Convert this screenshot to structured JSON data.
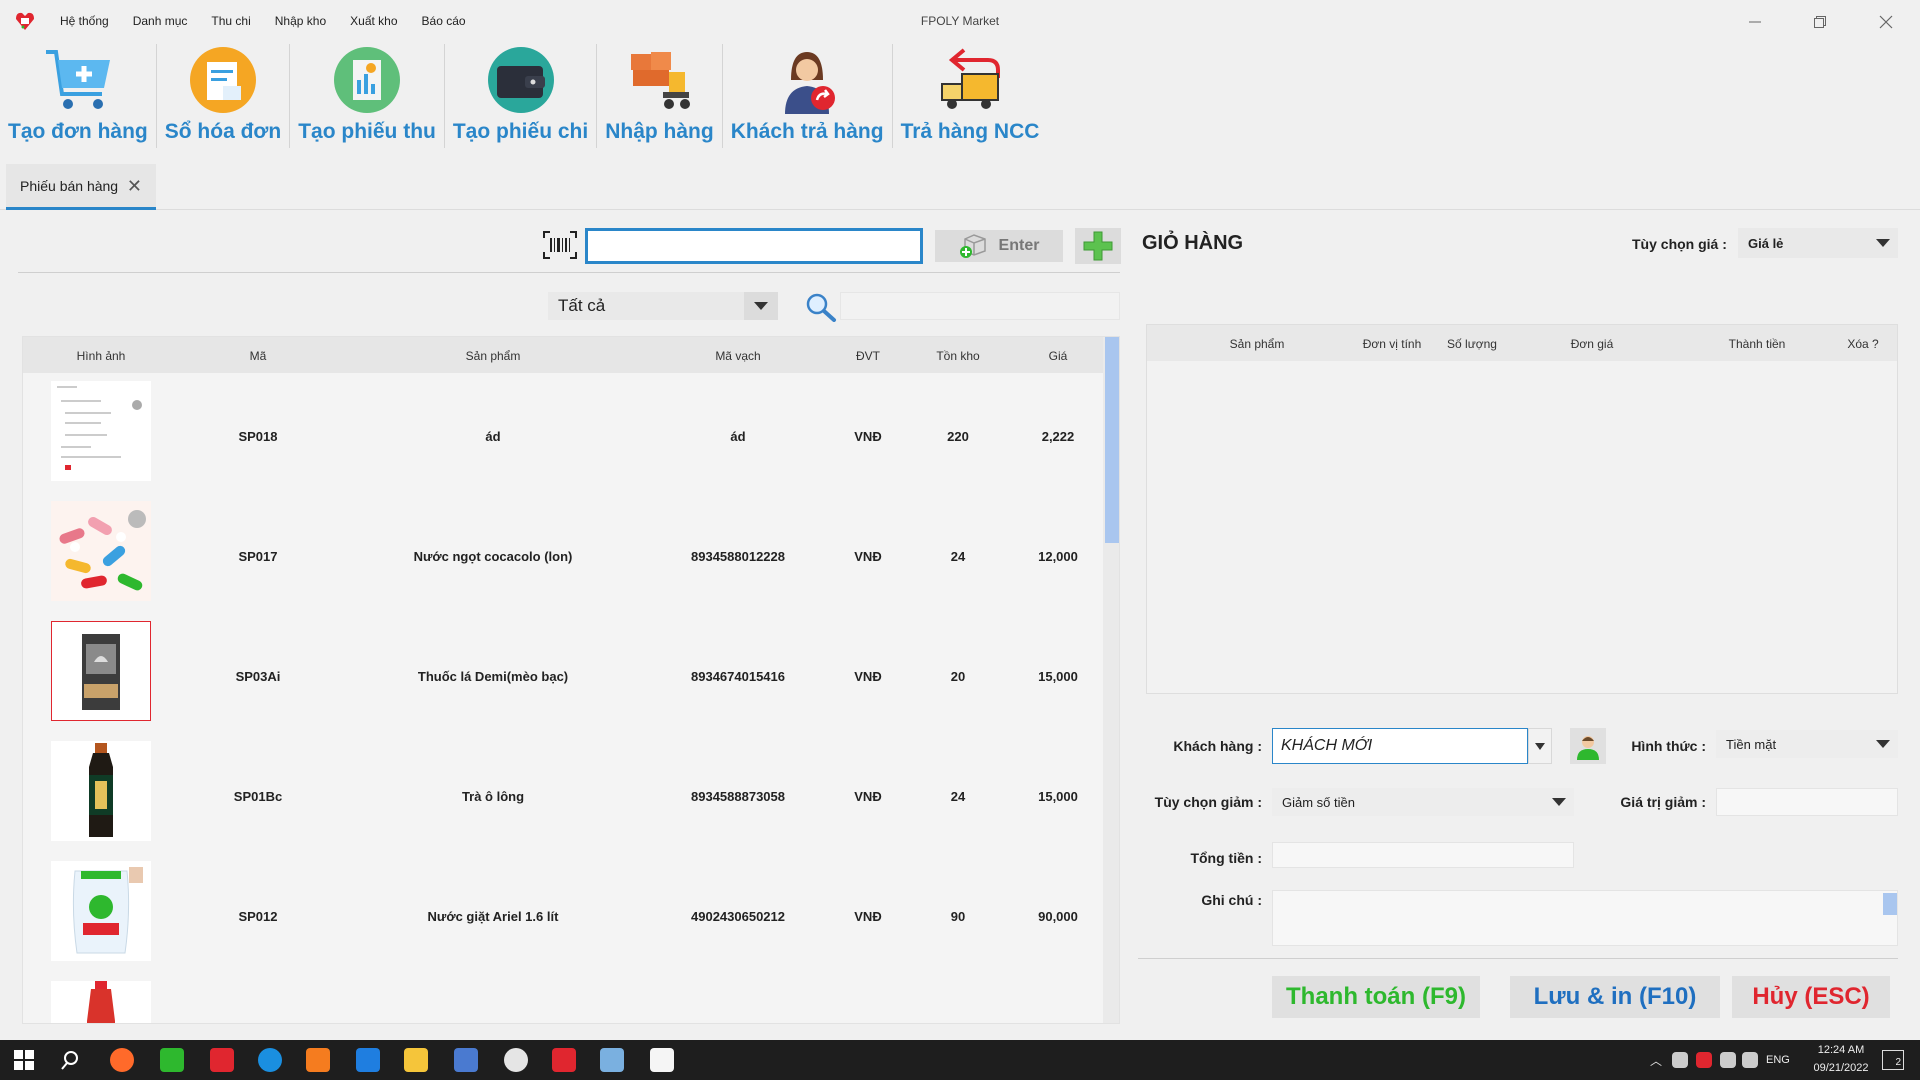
{
  "window": {
    "title": "FPOLY Market"
  },
  "menu": [
    "Hệ thống",
    "Danh mục",
    "Thu chi",
    "Nhập kho",
    "Xuất kho",
    "Báo cáo"
  ],
  "toolbar": [
    {
      "label": "Tạo đơn hàng",
      "icon": "cart-icon"
    },
    {
      "label": "Sổ hóa đơn",
      "icon": "invoice-book-icon"
    },
    {
      "label": "Tạo phiếu thu",
      "icon": "receipt-icon"
    },
    {
      "label": "Tạo phiếu chi",
      "icon": "wallet-icon"
    },
    {
      "label": "Nhập hàng",
      "icon": "forklift-icon"
    },
    {
      "label": "Khách trả hàng",
      "icon": "customer-return-icon"
    },
    {
      "label": "Trả hàng NCC",
      "icon": "truck-return-icon"
    }
  ],
  "tab": {
    "label": "Phiếu bán hàng"
  },
  "search": {
    "barcode_value": "",
    "enter_label": "Enter",
    "category": "Tất cả",
    "keyword": ""
  },
  "products": {
    "columns": [
      "Hình ảnh",
      "Mã",
      "Sản phẩm",
      "Mã vạch",
      "ĐVT",
      "Tồn kho",
      "Giá"
    ],
    "rows": [
      {
        "code": "SP018",
        "name": "ád",
        "barcode": "ád",
        "unit": "VNĐ",
        "stock": "220",
        "price": "2,222",
        "image": "document-thumbnail"
      },
      {
        "code": "SP017",
        "name": "Nước ngọt cocacolo (lon)",
        "barcode": "8934588012228",
        "unit": "VNĐ",
        "stock": "24",
        "price": "12,000",
        "image": "pills-thumbnail"
      },
      {
        "code": "SP03Ai",
        "name": "Thuốc lá Demi(mèo bạc)",
        "barcode": "8934674015416",
        "unit": "VNĐ",
        "stock": "20",
        "price": "15,000",
        "image": "cigarette-pack-thumbnail"
      },
      {
        "code": "SP01Bc",
        "name": "Trà ô lông",
        "barcode": "8934588873058",
        "unit": "VNĐ",
        "stock": "24",
        "price": "15,000",
        "image": "tea-bottle-thumbnail"
      },
      {
        "code": "SP012",
        "name": "Nước giặt Ariel 1.6 lít",
        "barcode": "4902430650212",
        "unit": "VNĐ",
        "stock": "90",
        "price": "90,000",
        "image": "detergent-bag-thumbnail"
      }
    ]
  },
  "cart": {
    "title": "GIỎ HÀNG",
    "price_option_label": "Tùy chọn giá :",
    "price_option": "Giá lẻ",
    "columns": [
      "Sản phẩm",
      "Đơn vị tính",
      "Số lượng",
      "Đơn giá",
      "Thành tiền",
      "Xóa ?"
    ]
  },
  "form": {
    "customer_label": "Khách hàng :",
    "customer_value": "KHÁCH MỚI",
    "payment_label": "Hình thức :",
    "payment_value": "Tiền mặt",
    "discount_option_label": "Tùy chọn giảm :",
    "discount_option_value": "Giảm số tiền",
    "discount_value_label": "Giá trị giảm :",
    "discount_value": "",
    "total_label": "Tổng tiền :",
    "total_value": "",
    "note_label": "Ghi chú :",
    "note_value": ""
  },
  "actions": {
    "pay": "Thanh toán (F9)",
    "save_print": "Lưu & in (F10)",
    "cancel": "Hủy (ESC)"
  },
  "colors": {
    "accent": "#2a86c9",
    "pay": "#2eb82e",
    "save": "#1f6fc0",
    "cancel": "#e0262f"
  },
  "taskbar": {
    "lang": "ENG",
    "time": "12:24 AM",
    "date": "09/21/2022",
    "notifications": "2"
  }
}
